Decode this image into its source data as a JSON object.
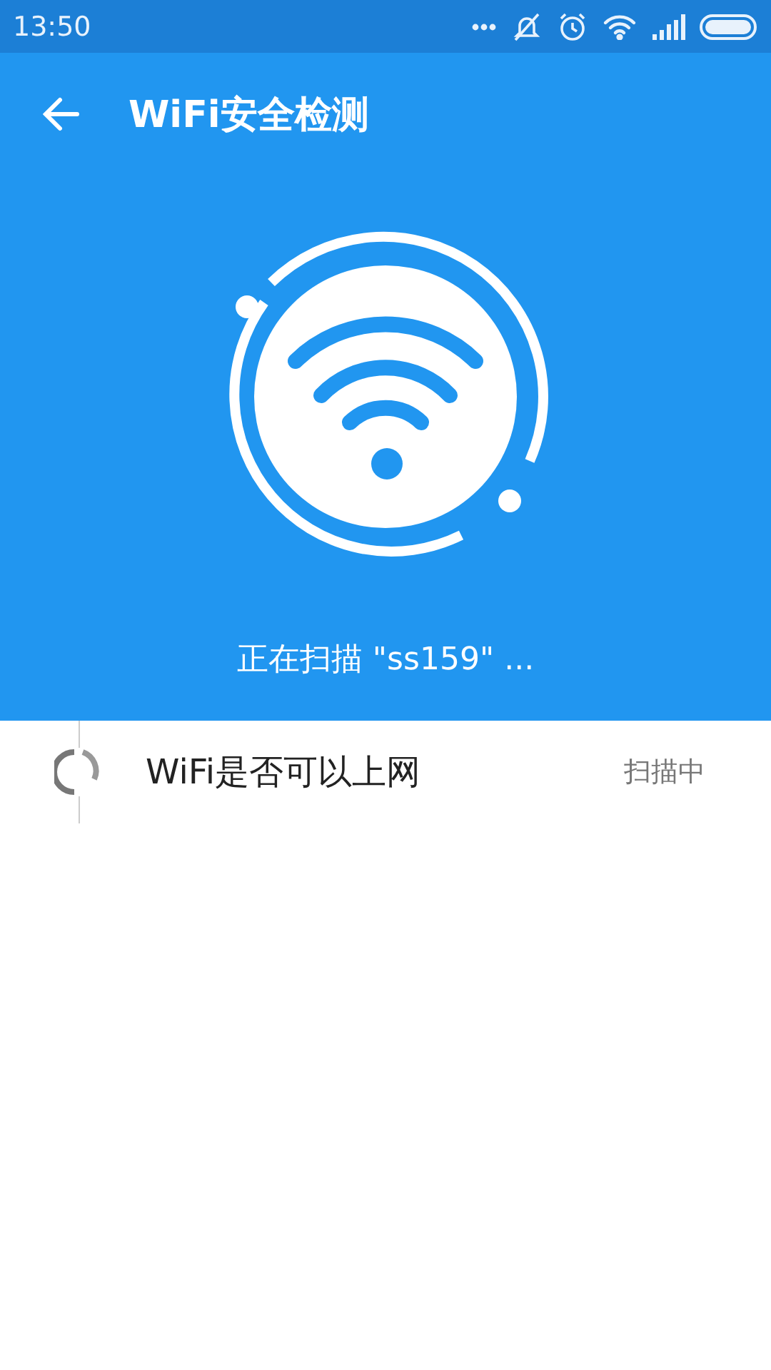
{
  "status_bar": {
    "time": "13:50"
  },
  "toolbar": {
    "title": "WiFi安全检测"
  },
  "scan": {
    "message": "正在扫描 \"ss159\" ..."
  },
  "checks": [
    {
      "label": "WiFi是否可以上网",
      "status": "扫描中"
    }
  ]
}
